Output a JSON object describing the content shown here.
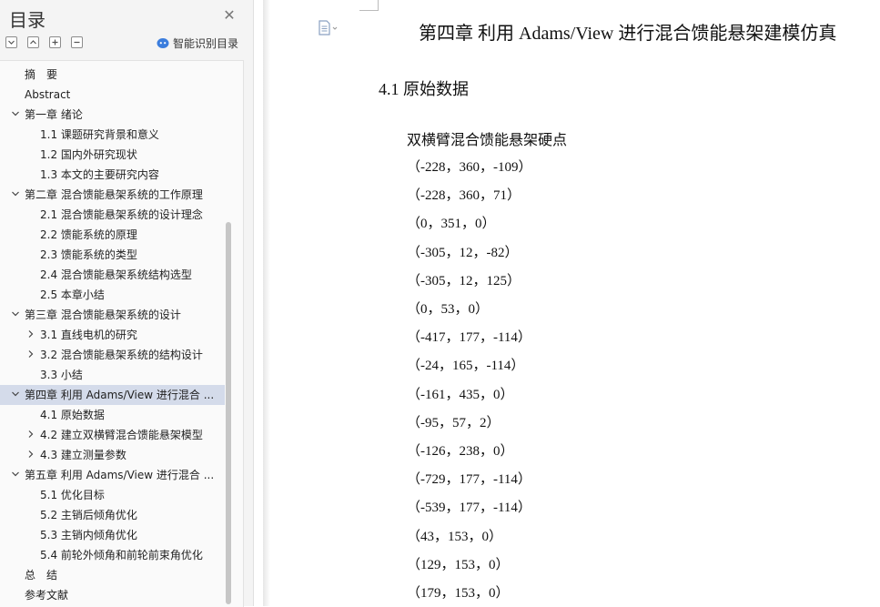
{
  "sidebar": {
    "title": "目录",
    "smart_toc_label": "智能识别目录",
    "toc": [
      {
        "label": "摘　要"
      },
      {
        "label": "Abstract"
      },
      {
        "label": "第一章  绪论"
      },
      {
        "label": "1.1 课题研究背景和意义"
      },
      {
        "label": "1.2 国内外研究现状"
      },
      {
        "label": "1.3 本文的主要研究内容"
      },
      {
        "label": "第二章  混合馈能悬架系统的工作原理"
      },
      {
        "label": "2.1 混合馈能悬架系统的设计理念"
      },
      {
        "label": "2.2 馈能系统的原理"
      },
      {
        "label": "2.3 馈能系统的类型"
      },
      {
        "label": "2.4 混合馈能悬架系统结构选型"
      },
      {
        "label": "2.5 本章小结"
      },
      {
        "label": "第三章  混合馈能悬架系统的设计"
      },
      {
        "label": "3.1 直线电机的研究"
      },
      {
        "label": "3.2 混合馈能悬架系统的结构设计"
      },
      {
        "label": "3.3  小结"
      },
      {
        "label": "第四章  利用 Adams/View 进行混合 ..."
      },
      {
        "label": "4.1 原始数据"
      },
      {
        "label": "4.2 建立双横臂混合馈能悬架模型"
      },
      {
        "label": "4.3 建立测量参数"
      },
      {
        "label": "第五章  利用 Adams/View 进行混合 ..."
      },
      {
        "label": "5.1 优化目标"
      },
      {
        "label": "5.2 主销后倾角优化"
      },
      {
        "label": "5.3 主销内倾角优化"
      },
      {
        "label": "5.4 前轮外倾角和前轮前束角优化"
      },
      {
        "label": "总　结"
      },
      {
        "label": "参考文献"
      }
    ]
  },
  "document": {
    "chapter_title": "第四章  利用 Adams/View 进行混合馈能悬架建模仿真",
    "section_title": "4.1 原始数据",
    "points_heading": "双横臂混合馈能悬架硬点",
    "points": [
      "（-228，360，-109）",
      "（-228，360，71）",
      "（0，351，0）",
      "（-305，12，-82）",
      "（-305，12，125）",
      "（0，53，0）",
      "（-417，177，-114）",
      "（-24，165，-114）",
      "（-161，435，0）",
      "（-95，57，2）",
      "（-126，238，0）",
      "（-729，177，-114）",
      "（-539，177，-114）",
      "（43，153，0）",
      "（129，153，0）",
      "（179，153，0）"
    ]
  },
  "colors": {
    "sidebar_bg": "#f4f4f4",
    "toc_bg": "#fafafa",
    "selected_row": "#d4dbea",
    "ai_icon": "#3b7ddd",
    "text": "#222222"
  },
  "icons": {
    "close": "close-icon",
    "collapse_all": "collapse-all-icon",
    "expand_up": "chevron-up-icon",
    "add": "plus-icon",
    "remove": "minus-icon",
    "smart_toc": "ai-robot-icon",
    "doc": "document-icon"
  }
}
